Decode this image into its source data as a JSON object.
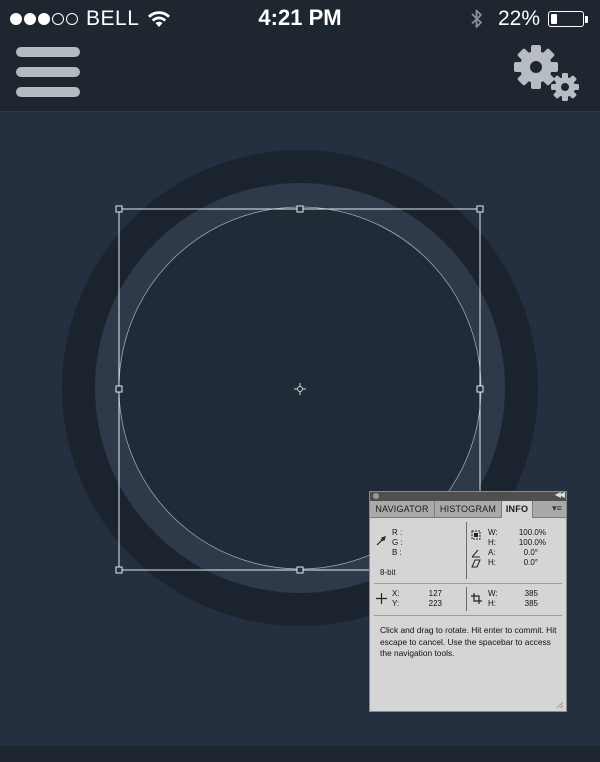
{
  "status_bar": {
    "carrier": "BELL",
    "time": "4:21 PM",
    "battery_percent": "22%",
    "battery_level": 0.22,
    "signal_dots_filled": 3,
    "signal_dots_total": 5,
    "icons": [
      "wifi-icon",
      "bluetooth-icon",
      "battery-icon"
    ]
  },
  "nav": {
    "icons": [
      "hamburger-menu-icon",
      "settings-gears-icon"
    ]
  },
  "colors": {
    "background": "#243040",
    "bars": "#1e2630",
    "outer_ring": "#1b232e",
    "inner_ring": "#2e3a4a",
    "inner_disc": "#212b38",
    "selection": "#ffffff"
  },
  "info_panel": {
    "tabs": [
      "NAVIGATOR",
      "HISTOGRAM",
      "INFO"
    ],
    "active_tab": "INFO",
    "color_labels": [
      "R :",
      "G :",
      "B :"
    ],
    "bit_depth": "8-bit",
    "transform": {
      "w_label": "W:",
      "w_value": "100.0%",
      "h_label": "H:",
      "h_value": "100.0%",
      "angle_label": "A:",
      "angle_value": "0.0°",
      "skew_label": "H:",
      "skew_value": "0.0°"
    },
    "position": {
      "x_label": "X:",
      "x_value": "127",
      "y_label": "Y:",
      "y_value": "223"
    },
    "size": {
      "w_label": "W:",
      "w_value": "385",
      "h_label": "H:",
      "h_value": "385"
    },
    "hint": "Click and drag to rotate. Hit enter to commit. Hit escape to cancel. Use the spacebar to access the navigation tools."
  }
}
